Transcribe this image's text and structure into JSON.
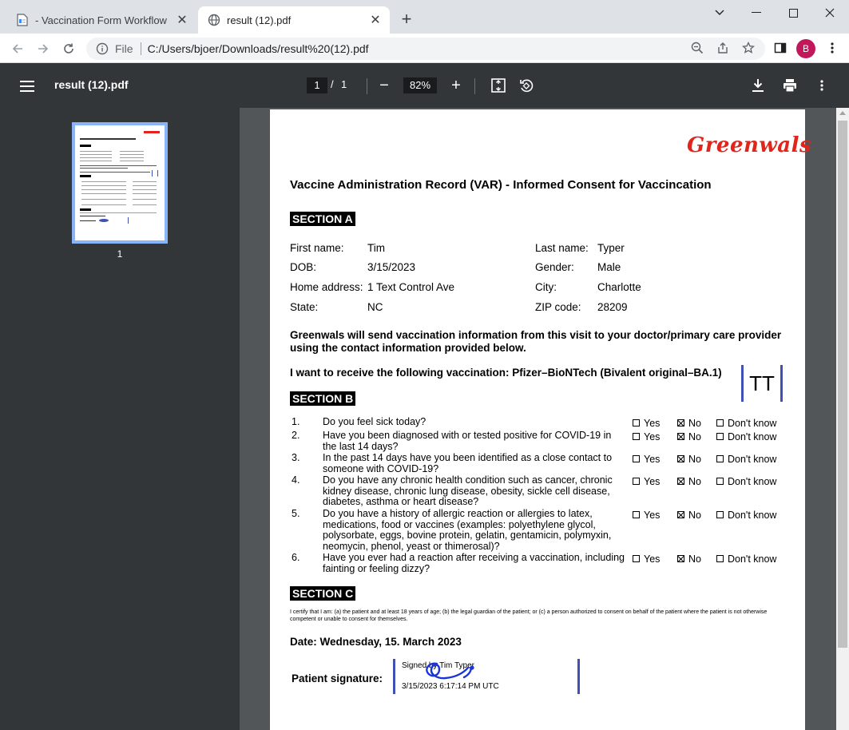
{
  "browser": {
    "tabs": [
      {
        "title": "- Vaccination Form Workflow",
        "active": false
      },
      {
        "title": "result (12).pdf",
        "active": true
      }
    ],
    "new_tab_label": "+",
    "address": {
      "scheme": "File",
      "url": "C:/Users/bjoer/Downloads/result%20(12).pdf"
    },
    "profile_initial": "B",
    "profile_color": "#c2185b"
  },
  "pdf_toolbar": {
    "title": "result (12).pdf",
    "current_page": "1",
    "page_separator": "/",
    "total_pages": "1",
    "zoom": "82%",
    "zoom_out_label": "−",
    "zoom_in_label": "+"
  },
  "sidebar": {
    "thumbnail_label": "1"
  },
  "document": {
    "brand": "Greenwals",
    "brand_color": "#e1251b",
    "heading": "Vaccine Administration Record (VAR) - Informed Consent for Vaccincation",
    "section_a": {
      "label": "SECTION A",
      "fields": [
        {
          "label": "First name:",
          "value": "Tim"
        },
        {
          "label": "Last name:",
          "value": "Typer"
        },
        {
          "label": "DOB:",
          "value": "3/15/2023"
        },
        {
          "label": "Gender:",
          "value": "Male"
        },
        {
          "label": "Home address:",
          "value": "1 Text Control Ave"
        },
        {
          "label": "City:",
          "value": "Charlotte"
        },
        {
          "label": "State:",
          "value": "NC"
        },
        {
          "label": "ZIP code:",
          "value": "28209"
        }
      ]
    },
    "notice": "Greenwals will send vaccination information from this visit to your doctor/primary care provider using the contact information provided below.",
    "vaccination_request": "I want to receive the following vaccination: Pfizer–BioNTech (Bivalent original–BA.1)",
    "initials": "TT",
    "section_b": {
      "label": "SECTION B",
      "options": {
        "yes": "Yes",
        "no": "No",
        "dont_know": "Don't know"
      },
      "questions": [
        {
          "num": "1.",
          "text": "Do you feel sick today?",
          "answer": "no"
        },
        {
          "num": "2.",
          "text": "Have you been diagnosed with or tested positive for COVID-19 in the last 14 days?",
          "answer": "no"
        },
        {
          "num": "3.",
          "text": "In the past 14 days have you been identified as a close contact to someone with COVID-19?",
          "answer": "no"
        },
        {
          "num": "4.",
          "text": "Do you have any chronic health condition such as cancer, chronic kidney disease, chronic lung disease, obesity, sickle cell disease, diabetes, asthma or heart disease?",
          "answer": "no"
        },
        {
          "num": "5.",
          "text": "Do you have a history of allergic reaction or allergies to latex, medications, food or vaccines (examples: polyethylene glycol, polysorbate, eggs, bovine protein, gelatin, gentamicin, polymyxin, neomycin, phenol, yeast or thimerosal)?",
          "answer": "no"
        },
        {
          "num": "6.",
          "text": "Have you ever had a reaction after receiving a vaccination, including fainting or feeling dizzy?",
          "answer": "no"
        }
      ]
    },
    "section_c": {
      "label": "SECTION C",
      "certification": "I certify that I am: (a) the patient and at least 18 years of age; (b) the legal guardian of the patient; or (c) a person authorized to consent on behalf of the patient where the patient is not otherwise competent or unable to consent for themselves."
    },
    "date_line": "Date: Wednesday, 15. March 2023",
    "signature": {
      "label": "Patient signature:",
      "signed_by": "Signed by Tim Typer",
      "timestamp": "3/15/2023 6:17:14 PM UTC"
    }
  }
}
